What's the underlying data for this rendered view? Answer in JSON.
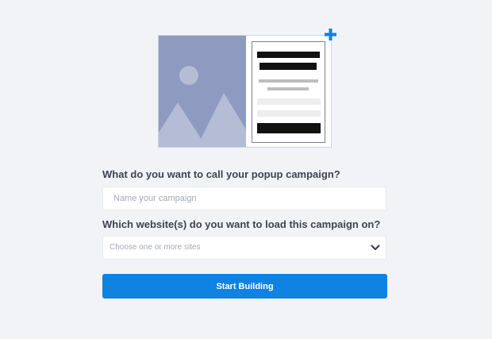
{
  "form": {
    "name_question": "What do you want to call your popup campaign?",
    "name_placeholder": "Name your campaign",
    "name_value": "",
    "sites_question": "Which website(s) do you want to load this campaign on?",
    "sites_placeholder": "Choose one or more sites",
    "submit_label": "Start Building"
  },
  "icons": {
    "add": "plus-icon",
    "dropdown": "chevron-down-icon",
    "image_placeholder": "landscape-image-icon"
  },
  "colors": {
    "background": "#f1f3f7",
    "accent": "#1082e0",
    "illustration_image": "#8f9ac0",
    "text": "#3c4352",
    "placeholder": "#a3a9b6"
  }
}
